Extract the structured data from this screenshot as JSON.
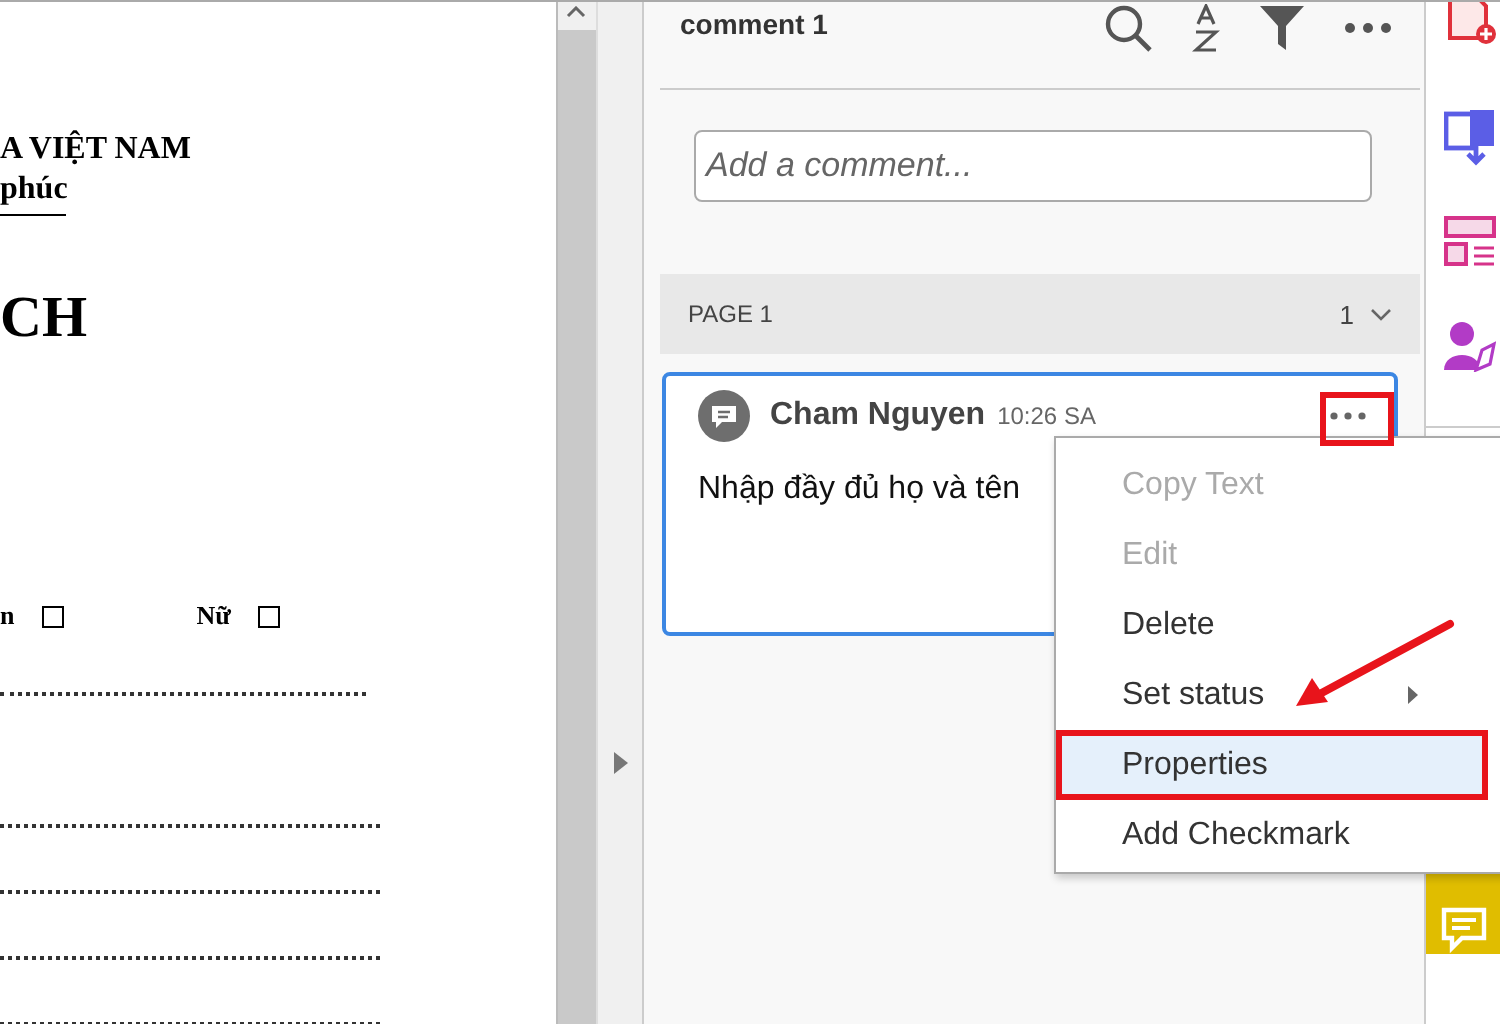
{
  "document": {
    "lines": [
      {
        "kind": "heading",
        "text": "A VIỆT NAM"
      },
      {
        "kind": "subheading",
        "text": "phúc"
      },
      {
        "kind": "title",
        "text": "CH"
      }
    ],
    "gender_row": [
      {
        "label": "n",
        "checked": false
      },
      {
        "label": "Nữ",
        "checked": false
      }
    ]
  },
  "panel": {
    "title": "comment 1",
    "input": {
      "placeholder": "Add a comment..."
    },
    "page_group": {
      "label": "PAGE 1",
      "count": "1",
      "expanded": true
    },
    "comments": [
      {
        "author": "Cham Nguyen",
        "time": "10:26 SA",
        "text": "Nhập đầy đủ họ và tên",
        "selected": true
      }
    ]
  },
  "context_menu": [
    {
      "label": "Copy Text",
      "disabled": true,
      "selected": false,
      "submenu": false
    },
    {
      "label": "Edit",
      "disabled": true,
      "selected": false,
      "submenu": false
    },
    {
      "label": "Delete",
      "disabled": false,
      "selected": false,
      "submenu": false
    },
    {
      "label": "Set status",
      "disabled": false,
      "selected": false,
      "submenu": true
    },
    {
      "label": "Properties",
      "disabled": false,
      "selected": true,
      "submenu": false
    },
    {
      "label": "Add Checkmark",
      "disabled": false,
      "selected": false,
      "submenu": false
    }
  ],
  "tool_rail": [
    {
      "kind": "create-pdf",
      "selected": false
    },
    {
      "kind": "export-pdf",
      "selected": false
    },
    {
      "kind": "organize",
      "selected": false
    },
    {
      "kind": "sign",
      "selected": false
    },
    {
      "kind": "comment",
      "selected": true
    }
  ]
}
